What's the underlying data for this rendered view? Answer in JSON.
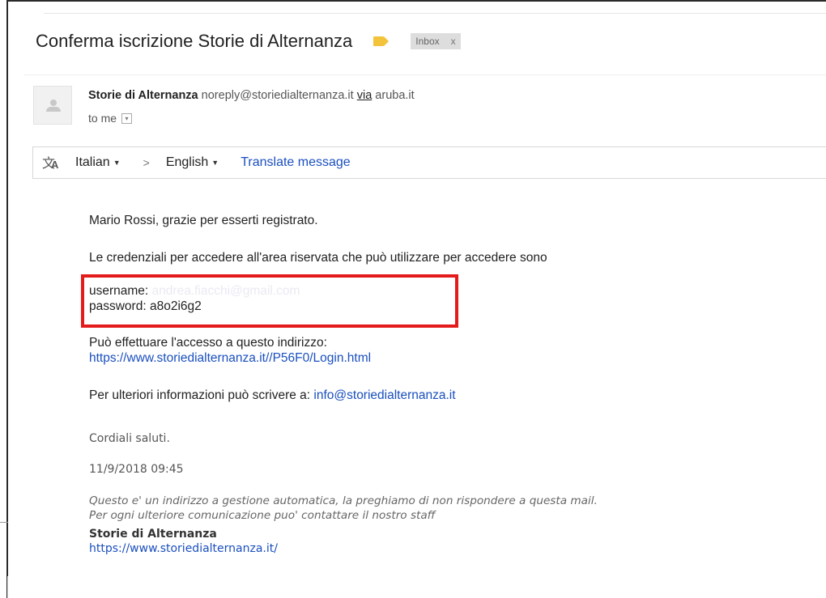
{
  "email": {
    "subject": "Conferma iscrizione Storie di Alternanza",
    "label_icon": "label-tag-icon",
    "inbox_label": "Inbox",
    "inbox_close": "x",
    "sender": {
      "name": "Storie di Alternanza",
      "email": "noreply@storiedialternanza.it",
      "via": "via",
      "domain": "aruba.it"
    },
    "to_line": "to me",
    "translate_bar": {
      "from_language": "Italian",
      "to_language": "English",
      "arrow": ">",
      "link": "Translate message"
    },
    "body": {
      "greeting": "Mario Rossi, grazie per esserti registrato.",
      "credentials_intro": "Le credenziali per accedere all'area riservata che può utilizzare per accedere sono",
      "username_label": "username:",
      "username_value": "andrea.fiacchi@gmail.com",
      "password_label": "password:",
      "password_value": "a8o2i6g2",
      "access_text": "Può effettuare l'accesso a questo indirizzo:",
      "access_url": "https://www.storiedialternanza.it//P56F0/Login.html",
      "more_info_text": "Per ulteriori informazioni può scrivere a:",
      "more_info_email": "info@storiedialternanza.it",
      "closing": "Cordiali saluti.",
      "date": "11/9/2018 09:45",
      "note_line1": "Questo e' un indirizzo a gestione automatica, la preghiamo di non rispondere a questa mail.",
      "note_line2": "Per ogni ulteriore comunicazione puo' contattare il nostro staff",
      "signature_name": "Storie di Alternanza",
      "signature_url": "https://www.storiedialternanza.it/"
    }
  },
  "colors": {
    "highlight_box": "#e41b1b",
    "link": "#1a4fbf",
    "label_tag": "#f3c33b"
  }
}
